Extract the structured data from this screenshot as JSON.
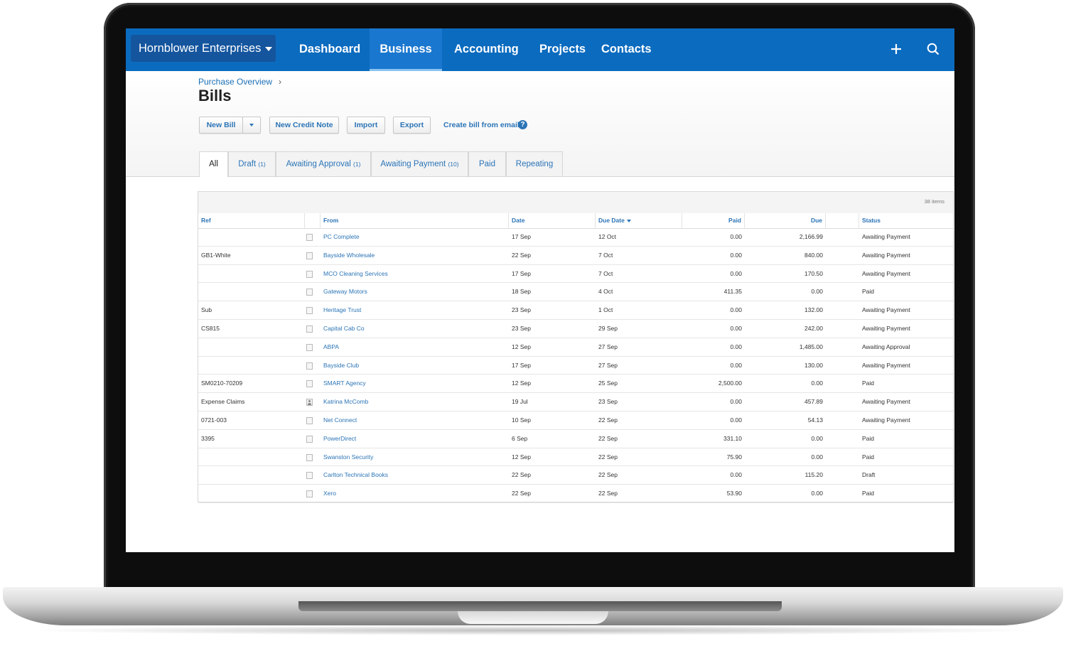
{
  "nav": {
    "org_name": "Hornblower Enterprises",
    "links": [
      "Dashboard",
      "Business",
      "Accounting",
      "Projects",
      "Contacts"
    ],
    "active": "Business",
    "icons": [
      "plus-icon",
      "search-icon"
    ]
  },
  "page": {
    "breadcrumb": "Purchase Overview",
    "breadcrumb_sep": "›",
    "title": "Bills"
  },
  "toolbar": {
    "new_bill": "New Bill",
    "new_credit_note": "New Credit Note",
    "import": "Import",
    "export": "Export",
    "create_from_email": "Create bill from email",
    "help": "?"
  },
  "tabs": [
    {
      "label": "All",
      "count": ""
    },
    {
      "label": "Draft",
      "count": "(1)"
    },
    {
      "label": "Awaiting Approval",
      "count": "(1)"
    },
    {
      "label": "Awaiting Payment",
      "count": "(10)"
    },
    {
      "label": "Paid",
      "count": ""
    },
    {
      "label": "Repeating",
      "count": ""
    }
  ],
  "table": {
    "items_count": "38 items",
    "headers": {
      "ref": "Ref",
      "from": "From",
      "date": "Date",
      "due_date": "Due Date",
      "paid": "Paid",
      "due": "Due",
      "status": "Status"
    },
    "rows": [
      {
        "ref": "",
        "icon": "doc",
        "from": "PC Complete",
        "date": "17 Sep",
        "due_date": "12 Oct",
        "paid": "0.00",
        "due": "2,166.99",
        "status": "Awaiting Payment"
      },
      {
        "ref": "GB1-White",
        "icon": "doc",
        "from": "Bayside Wholesale",
        "date": "22 Sep",
        "due_date": "7 Oct",
        "paid": "0.00",
        "due": "840.00",
        "status": "Awaiting Payment"
      },
      {
        "ref": "",
        "icon": "doc",
        "from": "MCO Cleaning Services",
        "date": "17 Sep",
        "due_date": "7 Oct",
        "paid": "0.00",
        "due": "170.50",
        "status": "Awaiting Payment"
      },
      {
        "ref": "",
        "icon": "doc",
        "from": "Gateway Motors",
        "date": "18 Sep",
        "due_date": "4 Oct",
        "paid": "411.35",
        "due": "0.00",
        "status": "Paid"
      },
      {
        "ref": "Sub",
        "icon": "doc",
        "from": "Heritage Trust",
        "date": "23 Sep",
        "due_date": "1 Oct",
        "paid": "0.00",
        "due": "132.00",
        "status": "Awaiting Payment"
      },
      {
        "ref": "CS815",
        "icon": "doc",
        "from": "Capital Cab Co",
        "date": "23 Sep",
        "due_date": "29 Sep",
        "paid": "0.00",
        "due": "242.00",
        "status": "Awaiting Payment"
      },
      {
        "ref": "",
        "icon": "doc",
        "from": "ABPA",
        "date": "12 Sep",
        "due_date": "27 Sep",
        "paid": "0.00",
        "due": "1,485.00",
        "status": "Awaiting Approval"
      },
      {
        "ref": "",
        "icon": "doc",
        "from": "Bayside Club",
        "date": "17 Sep",
        "due_date": "27 Sep",
        "paid": "0.00",
        "due": "130.00",
        "status": "Awaiting Payment"
      },
      {
        "ref": "SM0210-70209",
        "icon": "doc",
        "from": "SMART Agency",
        "date": "12 Sep",
        "due_date": "25 Sep",
        "paid": "2,500.00",
        "due": "0.00",
        "status": "Paid"
      },
      {
        "ref": "Expense Claims",
        "icon": "person",
        "from": "Katrina McComb",
        "date": "19 Jul",
        "due_date": "23 Sep",
        "paid": "0.00",
        "due": "457.89",
        "status": "Awaiting Payment"
      },
      {
        "ref": "0721-003",
        "icon": "doc",
        "from": "Net Connect",
        "date": "10 Sep",
        "due_date": "22 Sep",
        "paid": "0.00",
        "due": "54.13",
        "status": "Awaiting Payment"
      },
      {
        "ref": "3395",
        "icon": "doc",
        "from": "PowerDirect",
        "date": "6 Sep",
        "due_date": "22 Sep",
        "paid": "331.10",
        "due": "0.00",
        "status": "Paid"
      },
      {
        "ref": "",
        "icon": "doc",
        "from": "Swanston Security",
        "date": "12 Sep",
        "due_date": "22 Sep",
        "paid": "75.90",
        "due": "0.00",
        "status": "Paid"
      },
      {
        "ref": "",
        "icon": "doc",
        "from": "Carlton Technical Books",
        "date": "22 Sep",
        "due_date": "22 Sep",
        "paid": "0.00",
        "due": "115.20",
        "status": "Draft"
      },
      {
        "ref": "",
        "icon": "doc",
        "from": "Xero",
        "date": "22 Sep",
        "due_date": "22 Sep",
        "paid": "53.90",
        "due": "0.00",
        "status": "Paid"
      }
    ]
  },
  "colors": {
    "nav_bg": "#0b6bbf",
    "org_bg": "#14559e",
    "link": "#2b74b6"
  }
}
